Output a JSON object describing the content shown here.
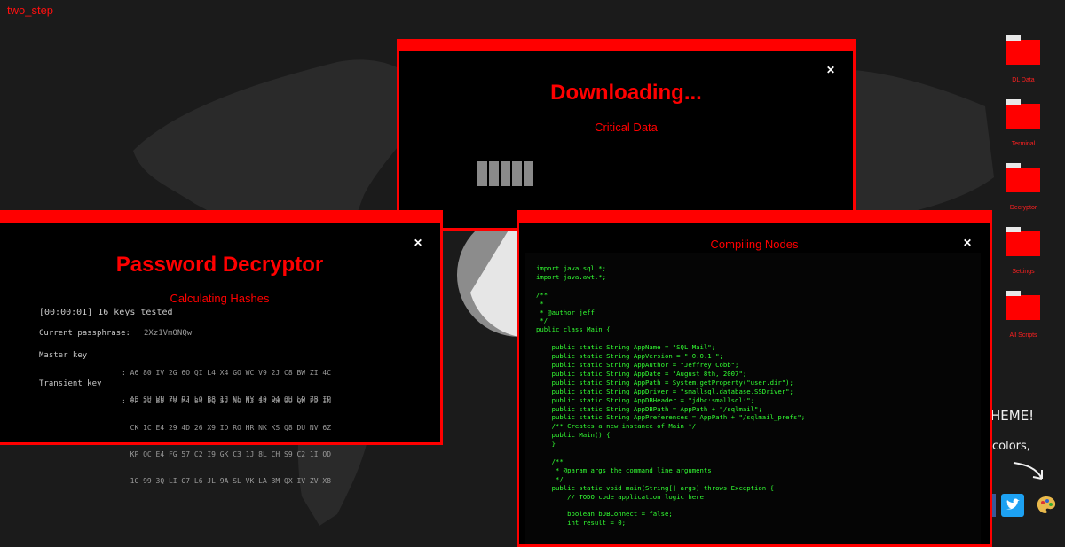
{
  "brand": "two_step",
  "desktop_icons": [
    {
      "label": "DL Data"
    },
    {
      "label": "Terminal"
    },
    {
      "label": "Decryptor"
    },
    {
      "label": "Settings"
    },
    {
      "label": "All Scripts"
    }
  ],
  "side_text": {
    "heme": "HEME!",
    "colors": "colors,"
  },
  "social": {
    "twitter_icon": "twitter-icon",
    "palette_icon": "palette-icon",
    "share_icon": "share-icon"
  },
  "download_window": {
    "title": "Downloading...",
    "subtitle": "Critical Data",
    "close": "✕",
    "progress_blocks": 5
  },
  "decryptor_window": {
    "title": "Password Decryptor",
    "subtitle": "Calculating Hashes",
    "close": "✕",
    "status_line": "[00:00:01] 16 keys tested",
    "passphrase_label": "Current passphrase:",
    "passphrase_value": "2Xz1VmONQw",
    "master_label": "Master key",
    "master_lines": [
      ": A6 80 IV 2G 6O QI L4 X4 GO WC V9 2J C8 BW ZI 4C",
      "  A5 SU VN 7H RJ LQ B8 1J NL NY 40 Q4 OU LP 7B IP"
    ],
    "transient_label": "Transient key",
    "transient_lines": [
      ": YP 3C B5 FY M4 84 5Q 5J NO N3 14 XW 0O QW PJ IN",
      "  CK 1C E4 29 4D 26 X9 ID RO HR NK KS Q8 DU NV 6Z",
      "  KP QC E4 FG 57 C2 I9 GK C3 1J 8L CH S9 C2 1I OD",
      "  1G 99 3Q LI G7 L6 JL 9A SL VK LA 3M QX IV ZV X8"
    ]
  },
  "compile_window": {
    "title": "Compiling Nodes",
    "close": "✕",
    "code": [
      "import java.sql.*;",
      "import java.awt.*;",
      "",
      "/**",
      " *",
      " * @author jeff",
      " */",
      "public class Main {",
      "",
      "    public static String AppName = \"SQL Mail\";",
      "    public static String AppVersion = \" 0.0.1 \";",
      "    public static String AppAuthor = \"Jeffrey Cobb\";",
      "    public static String AppDate = \"August 8th, 2007\";",
      "    public static String AppPath = System.getProperty(\"user.dir\");",
      "    public static String AppDriver = \"smallsql.database.SSDriver\";",
      "    public static String AppDBHeader = \"jdbc:smallsql:\";",
      "    public static String AppDBPath = AppPath + \"/sqlmail\";",
      "    public static String AppPreferences = AppPath + \"/sqlmail_prefs\";",
      "    /** Creates a new instance of Main */",
      "    public Main() {",
      "    }",
      "",
      "    /**",
      "     * @param args the command line arguments",
      "     */",
      "    public static void main(String[] args) throws Exception {",
      "        // TODO code application logic here",
      "",
      "        boolean bDBConnect = false;",
      "        int result = 0;"
    ]
  },
  "colors": {
    "accent": "#ff0000",
    "code": "#33ff33",
    "background": "#1b1b1b"
  }
}
